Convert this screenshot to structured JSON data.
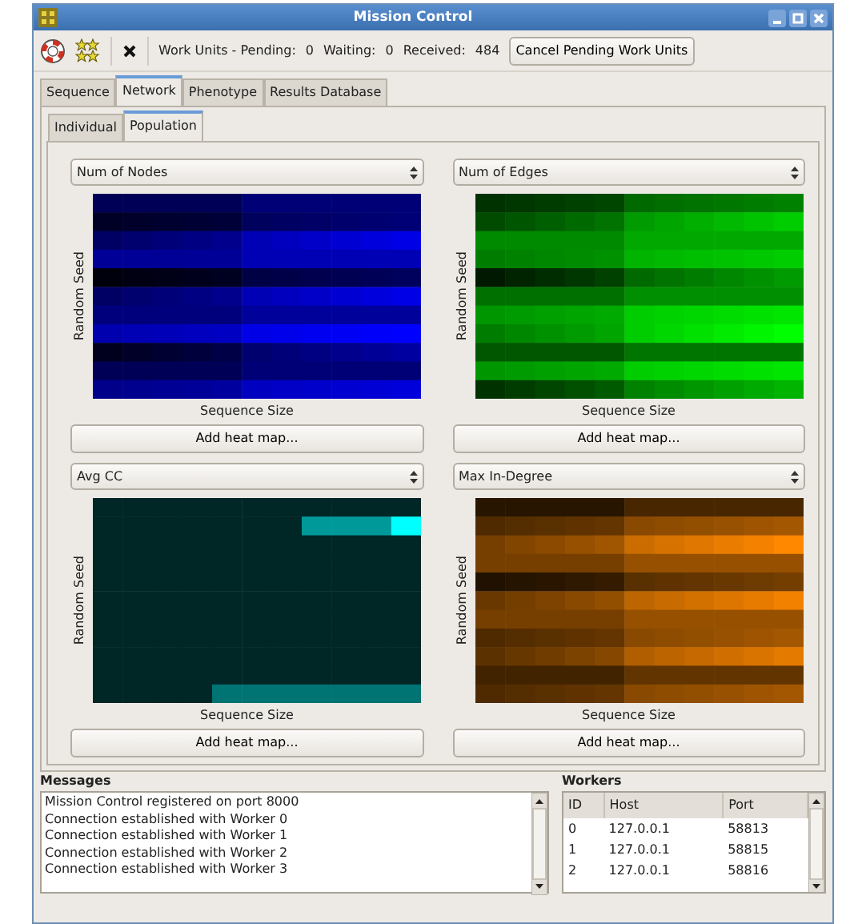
{
  "window": {
    "title": "Mission Control"
  },
  "toolbar": {
    "status": [
      {
        "label": "Work Units - Pending:",
        "value": "0"
      },
      {
        "label": "Waiting:",
        "value": "0"
      },
      {
        "label": "Received:",
        "value": "484"
      }
    ],
    "cancel_button": "Cancel Pending Work Units"
  },
  "tabs": [
    {
      "label": "Sequence",
      "selected": false
    },
    {
      "label": "Network",
      "selected": true
    },
    {
      "label": "Phenotype",
      "selected": false
    },
    {
      "label": "Results Database",
      "selected": false
    }
  ],
  "subtabs": [
    {
      "label": "Individual",
      "selected": false
    },
    {
      "label": "Population",
      "selected": true
    }
  ],
  "heat_maps": [
    {
      "metric": "Num of Nodes",
      "ylabel": "Random Seed",
      "xlabel": "Sequence Size",
      "button": "Add heat map...",
      "color": "#0000ff"
    },
    {
      "metric": "Num of Edges",
      "ylabel": "Random Seed",
      "xlabel": "Sequence Size",
      "button": "Add heat map...",
      "color": "#00ff00"
    },
    {
      "metric": "Avg CC",
      "ylabel": "Random Seed",
      "xlabel": "Sequence Size",
      "button": "Add heat map...",
      "color": "#00ffff"
    },
    {
      "metric": "Max In-Degree",
      "ylabel": "Random Seed",
      "xlabel": "Sequence Size",
      "button": "Add heat map...",
      "color": "#ff8800"
    }
  ],
  "messages": {
    "title": "Messages",
    "lines": [
      "Mission Control registered on port 8000",
      "Connection established with Worker 0",
      "Connection established with Worker 1",
      "Connection established with Worker 2",
      "Connection established with Worker 3"
    ]
  },
  "workers": {
    "title": "Workers",
    "columns": [
      "ID",
      "Host",
      "Port"
    ],
    "rows": [
      [
        "0",
        "127.0.0.1",
        "58813"
      ],
      [
        "1",
        "127.0.0.1",
        "58815"
      ],
      [
        "2",
        "127.0.0.1",
        "58816"
      ]
    ]
  }
}
